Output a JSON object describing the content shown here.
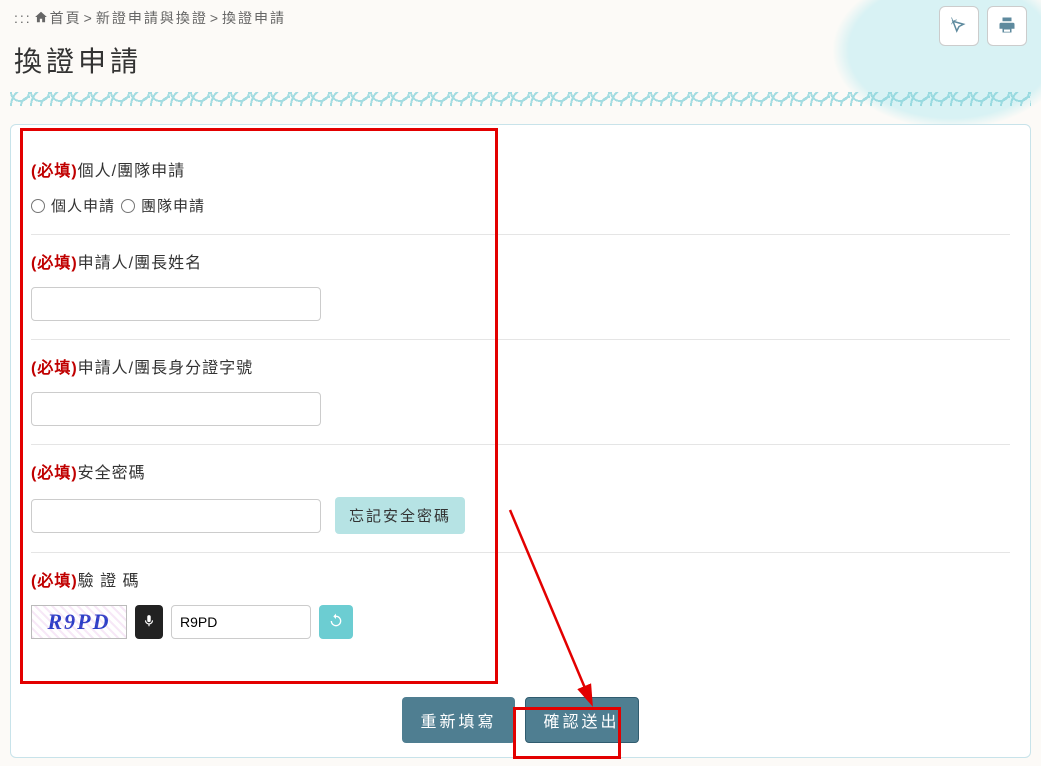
{
  "breadcrumb": {
    "prefix": ":::",
    "home": "首頁",
    "level2": "新證申請與換證",
    "level3": "換證申請",
    "sep": ">"
  },
  "page_title": "換證申請",
  "top_icons": {
    "accessibility": "accessibility-icon",
    "print": "print-icon"
  },
  "form": {
    "required_tag": "(必填)",
    "type": {
      "label": "個人/團隊申請",
      "opt1": "個人申請",
      "opt2": "團隊申請"
    },
    "name": {
      "label": "申請人/團長姓名",
      "value": ""
    },
    "idno": {
      "label": "申請人/團長身分證字號",
      "value": ""
    },
    "password": {
      "label": "安全密碼",
      "value": "",
      "forgot": "忘記安全密碼"
    },
    "captcha": {
      "label": "驗 證 碼",
      "image_text": "R9PD",
      "input_value": "R9PD"
    }
  },
  "buttons": {
    "reset": "重新填寫",
    "submit": "確認送出"
  }
}
